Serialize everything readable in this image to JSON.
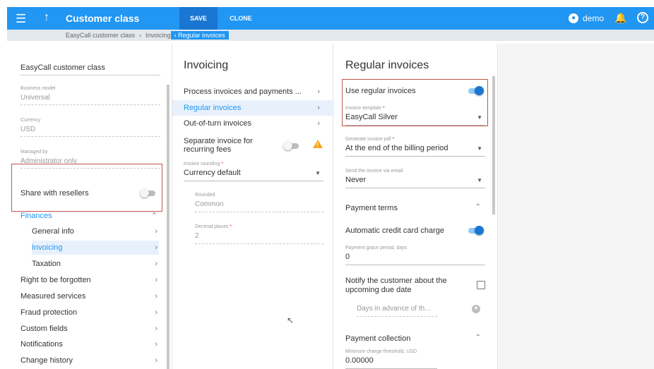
{
  "header": {
    "title": "Customer class",
    "save_label": "SAVE",
    "clone_label": "CLONE",
    "user": "demo"
  },
  "breadcrumbs": [
    "EasyCall customer class",
    "Invoicing",
    "Regular invoices"
  ],
  "sidebar": {
    "page_title": "EasyCall customer class",
    "fields": [
      {
        "label": "Business model",
        "value": "Universal"
      },
      {
        "label": "Currency",
        "value": "USD"
      },
      {
        "label": "Managed by",
        "value": "Administrator only"
      }
    ],
    "share_label": "Share with resellers",
    "share_on": false,
    "finances_label": "Finances",
    "finances_children": [
      "General info",
      "Invoicing",
      "Taxation"
    ],
    "items": [
      "Right to be forgotten",
      "Measured services",
      "Fraud protection",
      "Custom fields",
      "Notifications",
      "Change history"
    ]
  },
  "invoicing": {
    "title": "Invoicing",
    "items": [
      "Process invoices and payments ...",
      "Regular invoices",
      "Out-of-turn invoices"
    ],
    "separate_label": "Separate invoice for recurring fees",
    "separate_on": false,
    "rounding_label": "Invoice rounding",
    "rounding_value": "Currency default",
    "rounded_label": "Rounded",
    "rounded_value": "Common",
    "decimal_label": "Decimal places",
    "decimal_value": "2"
  },
  "regular": {
    "title": "Regular invoices",
    "use_label": "Use regular invoices",
    "use_on": true,
    "template_label": "Invoice template",
    "template_value": "EasyCall Silver",
    "pdf_label": "Generate invoice pdf",
    "pdf_value": "At the end of the billing period",
    "email_label": "Send the invoice via email",
    "email_value": "Never",
    "payment_terms_label": "Payment terms",
    "auto_cc_label": "Automatic credit card charge",
    "auto_cc_on": true,
    "grace_label": "Payment grace period, days",
    "grace_value": "0",
    "notify_label": "Notify the customer about the upcoming due date",
    "days_placeholder": "Days in advance of th...",
    "payment_collection_label": "Payment collection",
    "min_charge_label": "Minimum charge threshold, USD",
    "min_charge_value": "0.00000"
  },
  "colors": {
    "primary": "#2196f3",
    "primary_dark": "#1976d2",
    "highlight_border": "#c0574a",
    "warning": "#f5a623"
  }
}
